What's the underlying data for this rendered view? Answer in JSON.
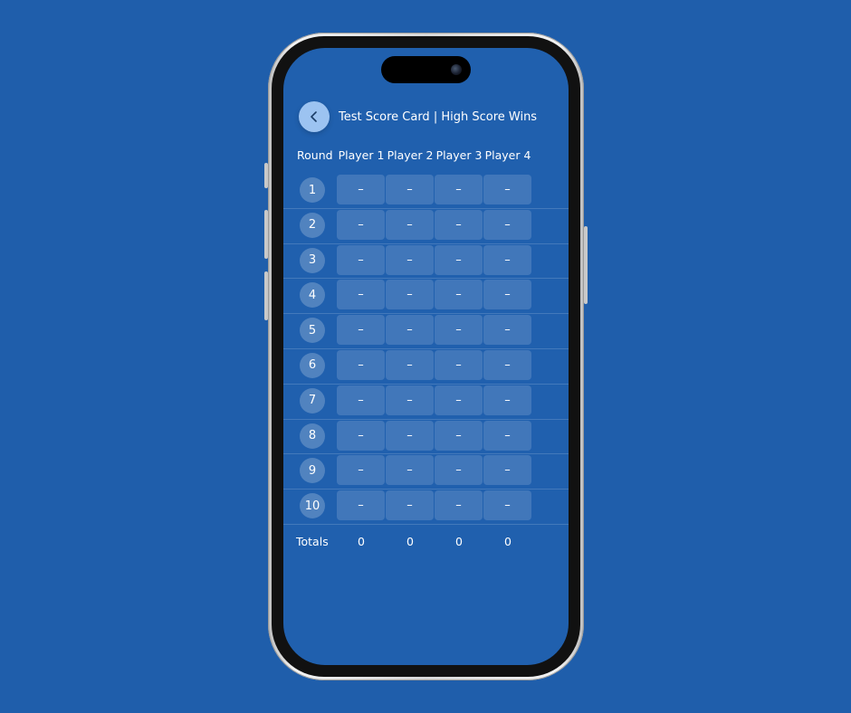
{
  "header": {
    "back_icon": "chevron-left-icon",
    "title": "Test Score Card | High Score Wins"
  },
  "columns": {
    "round": "Round",
    "players": [
      "Player 1",
      "Player 2",
      "Player 3",
      "Player 4"
    ]
  },
  "rows": [
    {
      "round": "1",
      "scores": [
        "–",
        "–",
        "–",
        "–"
      ]
    },
    {
      "round": "2",
      "scores": [
        "–",
        "–",
        "–",
        "–"
      ]
    },
    {
      "round": "3",
      "scores": [
        "–",
        "–",
        "–",
        "–"
      ]
    },
    {
      "round": "4",
      "scores": [
        "–",
        "–",
        "–",
        "–"
      ]
    },
    {
      "round": "5",
      "scores": [
        "–",
        "–",
        "–",
        "–"
      ]
    },
    {
      "round": "6",
      "scores": [
        "–",
        "–",
        "–",
        "–"
      ]
    },
    {
      "round": "7",
      "scores": [
        "–",
        "–",
        "–",
        "–"
      ]
    },
    {
      "round": "8",
      "scores": [
        "–",
        "–",
        "–",
        "–"
      ]
    },
    {
      "round": "9",
      "scores": [
        "–",
        "–",
        "–",
        "–"
      ]
    },
    {
      "round": "10",
      "scores": [
        "–",
        "–",
        "–",
        "–"
      ]
    }
  ],
  "totals": {
    "label": "Totals",
    "values": [
      "0",
      "0",
      "0",
      "0"
    ]
  },
  "colors": {
    "background": "#1f5eab",
    "screen": "#2060ae",
    "back_button": "#9cc3f1"
  }
}
